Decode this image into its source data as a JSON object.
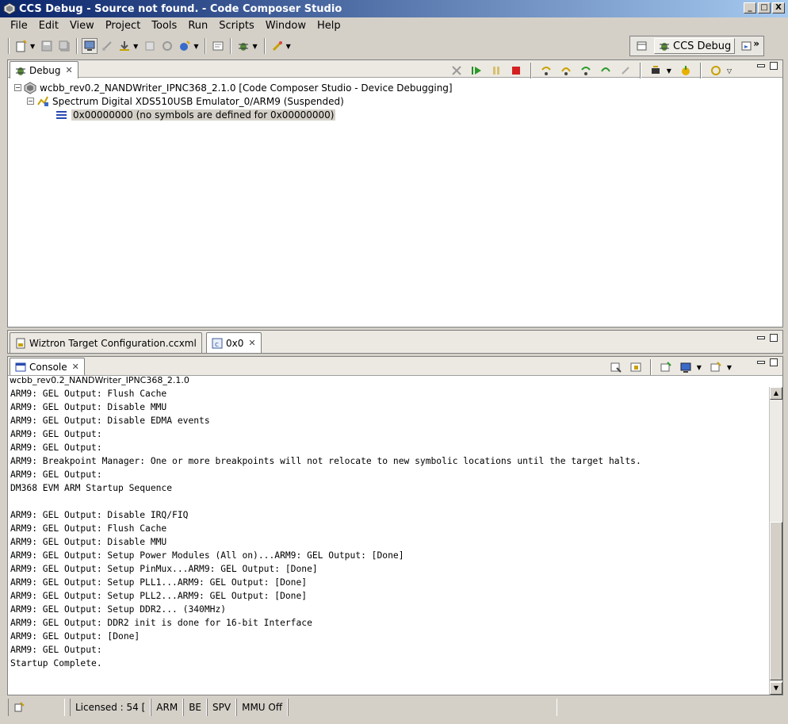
{
  "window": {
    "title": "CCS Debug - Source not found. - Code Composer Studio",
    "buttons": [
      "_",
      "□",
      "X"
    ]
  },
  "menu": [
    "File",
    "Edit",
    "View",
    "Project",
    "Tools",
    "Run",
    "Scripts",
    "Window",
    "Help"
  ],
  "perspective": {
    "label": "CCS Debug",
    "more": "»"
  },
  "debug_view": {
    "tab_label": "Debug",
    "tree": {
      "root": "wcbb_rev0.2_NANDWriter_IPNC368_2.1.0 [Code Composer Studio - Device Debugging]",
      "child": "Spectrum Digital XDS510USB Emulator_0/ARM9 (Suspended)",
      "frame": "0x00000000  (no symbols are defined for 0x00000000)"
    }
  },
  "editor_tabs": {
    "tab1": "Wiztron Target Configuration.ccxml",
    "tab2": "0x0"
  },
  "console": {
    "tab_label": "Console",
    "session_label": "wcbb_rev0.2_NANDWriter_IPNC368_2.1.0",
    "lines": [
      "ARM9: GEL Output: Flush Cache",
      "ARM9: GEL Output: Disable MMU",
      "ARM9: GEL Output: Disable EDMA events",
      "ARM9: GEL Output:",
      "ARM9: GEL Output:",
      "ARM9: Breakpoint Manager: One or more breakpoints will not relocate to new symbolic locations until the target halts.",
      "ARM9: GEL Output:",
      "DM368 EVM ARM Startup Sequence",
      "",
      "ARM9: GEL Output: Disable IRQ/FIQ",
      "ARM9: GEL Output: Flush Cache",
      "ARM9: GEL Output: Disable MMU",
      "ARM9: GEL Output: Setup Power Modules (All on)...ARM9: GEL Output: [Done]",
      "ARM9: GEL Output: Setup PinMux...ARM9: GEL Output: [Done]",
      "ARM9: GEL Output: Setup PLL1...ARM9: GEL Output: [Done]",
      "ARM9: GEL Output: Setup PLL2...ARM9: GEL Output: [Done]",
      "ARM9: GEL Output: Setup DDR2... (340MHz)",
      "ARM9: GEL Output: DDR2 init is done for 16-bit Interface",
      "ARM9: GEL Output: [Done]",
      "ARM9: GEL Output:",
      "Startup Complete."
    ]
  },
  "status": {
    "licensed": "Licensed : 54 [",
    "arch": "ARM",
    "endian": "BE",
    "mode": "SPV",
    "mmu": "MMU Off"
  }
}
